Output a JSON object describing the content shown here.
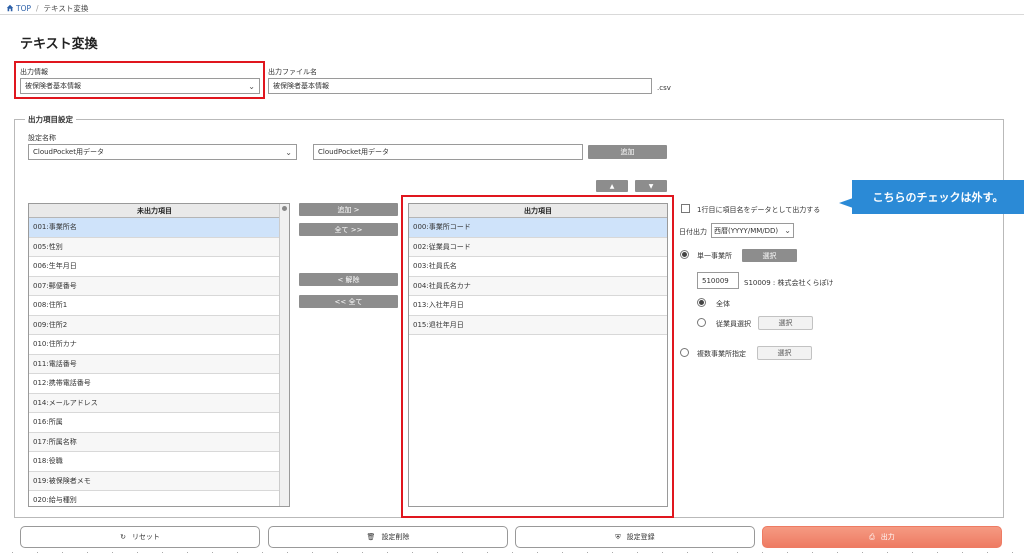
{
  "breadcrumb": {
    "home": "TOP",
    "separator": "/",
    "current": "テキスト変換"
  },
  "page_title": "テキスト変換",
  "output_info": {
    "label": "出力情報",
    "value": "被保険者基本情報"
  },
  "output_filename": {
    "label": "出力ファイル名",
    "value": "被保険者基本情報",
    "extension": ".csv"
  },
  "output_items_settings": {
    "legend": "出力項目設定",
    "setting_name_label": "設定名称",
    "setting_name_select": "CloudPocket用データ",
    "setting_name_input": "CloudPocket用データ",
    "add_button": "追加"
  },
  "unoutput_list": {
    "header": "未出力項目",
    "items": [
      "001:事業所名",
      "005:性別",
      "006:生年月日",
      "007:郵便番号",
      "008:住所1",
      "009:住所2",
      "010:住所カナ",
      "011:電話番号",
      "012:携帯電話番号",
      "014:メールアドレス",
      "016:所属",
      "017:所属名称",
      "018:役職",
      "019:被保険者メモ",
      "020:給与種別"
    ]
  },
  "transfer_buttons": {
    "add": "追加 >",
    "add_all": "全て >>",
    "remove": "< 解除",
    "remove_all": "<< 全て"
  },
  "output_list": {
    "header": "出力項目",
    "items": [
      "000:事業所コード",
      "002:従業員コード",
      "003:社員氏名",
      "004:社員氏名カナ",
      "013:入社年月日",
      "015:退社年月日"
    ]
  },
  "order_buttons": {
    "up": "▲",
    "down": "▼"
  },
  "options": {
    "first_row_header": "1行目に項目名をデータとして出力する",
    "date_output_label": "日付出力",
    "date_output_value": "西暦(YYYY/MM/DD)",
    "single_office_label": "単一事業所",
    "select_button": "選択",
    "office_code": "510009",
    "office_name": "S10009 : 株式会社くらぽけ",
    "all_label": "全体",
    "employee_select_label": "従業員選択",
    "multi_office_label": "複数事業所指定"
  },
  "callout": "こちらのチェックは外す。",
  "bottom": {
    "reset": "リセット",
    "delete": "設定削除",
    "register": "設定登録",
    "output": "出力"
  },
  "icons": {
    "home": "home-icon",
    "chevron": "chevron-down-icon",
    "reset": "reset-icon",
    "trash": "trash-icon",
    "save": "save-icon",
    "output": "output-icon"
  },
  "colors": {
    "accent_red": "#e0161e",
    "callout": "#2b8ad6",
    "primary_button": "#ee7b63",
    "selected_row": "#cfe3fa"
  }
}
